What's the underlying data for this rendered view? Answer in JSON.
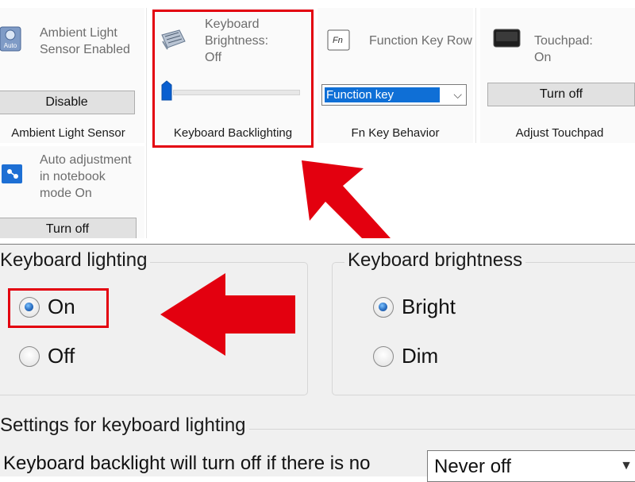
{
  "top_panel": {
    "ambient": {
      "icon": "ambient-light-sensor-icon",
      "icon_badge": "Auto",
      "status": "Ambient Light\nSensor Enabled",
      "button": "Disable",
      "caption": "Ambient Light Sensor"
    },
    "keyboard": {
      "icon": "keyboard-brightness-icon",
      "status": "Keyboard\nBrightness:\nOff",
      "slider_value": 0,
      "caption": "Keyboard Backlighting"
    },
    "fn": {
      "icon": "fn-key-icon",
      "icon_text": "Fn",
      "status": "Function Key Row",
      "select_value": "Function key",
      "caption": "Fn Key Behavior"
    },
    "touchpad": {
      "icon": "touchpad-icon",
      "status": "Touchpad:\nOn",
      "button": "Turn off",
      "caption": "Adjust Touchpad"
    },
    "notebook": {
      "icon": "auto-adjust-icon",
      "status": "Auto adjustment\nin notebook\nmode On",
      "button": "Turn off"
    }
  },
  "bottom_panel": {
    "keyboard_lighting": {
      "legend": "Keyboard lighting",
      "options": [
        "On",
        "Off"
      ],
      "selected": "On"
    },
    "keyboard_brightness": {
      "legend": "Keyboard brightness",
      "options": [
        "Bright",
        "Dim"
      ],
      "selected": "Bright"
    },
    "settings": {
      "legend": "Settings for keyboard lighting",
      "description": "Keyboard backlight will turn off if there is no",
      "dropdown_value": "Never off"
    }
  },
  "colors": {
    "highlight": "#e3000f",
    "selection": "#0f6fd6",
    "dialog_bg": "#f0f0f0"
  }
}
